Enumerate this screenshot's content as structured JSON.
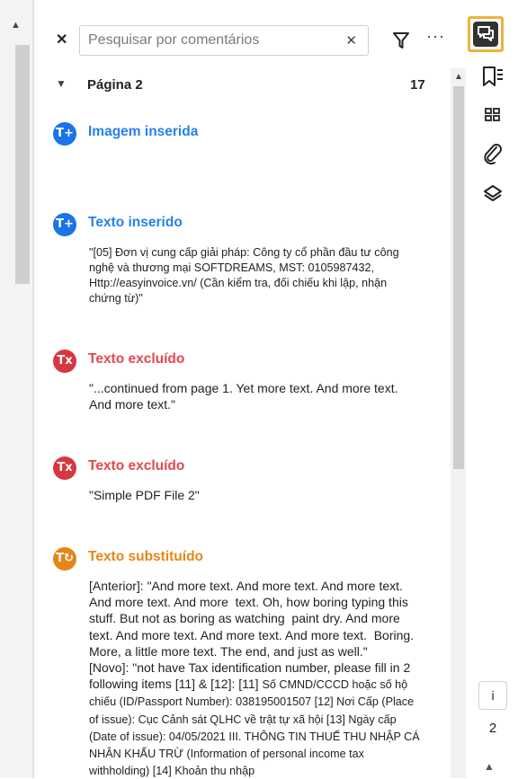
{
  "search": {
    "placeholder": "Pesquisar por comentários",
    "value": ""
  },
  "toolbar": {
    "more_label": "···"
  },
  "page_group": {
    "title": "Página 2",
    "count": "17"
  },
  "comments": [
    {
      "type": "Imagem inserida",
      "icon": "text-insert-icon",
      "color": "#2680eb",
      "body": ""
    },
    {
      "type": "Texto inserido",
      "icon": "text-insert-icon",
      "color": "#2680eb",
      "body": "\"[05] Đơn vị cung cấp giải pháp: Công ty cổ phần đầu tư công nghệ và thương mại SOFTDREAMS, MST: 0105987432, Http://easyinvoice.vn/ (Cần kiểm tra, đối chiếu khi lập, nhận chứng từ)\""
    },
    {
      "type": "Texto excluído",
      "icon": "text-strike-icon",
      "color": "#e34850",
      "body": "\"...continued from page 1. Yet more text. And more text. And more text.\""
    },
    {
      "type": "Texto excluído",
      "icon": "text-strike-icon",
      "color": "#e34850",
      "body": "\"Simple PDF File 2\""
    },
    {
      "type": "Texto substituído",
      "icon": "text-replace-icon",
      "color": "#e68619",
      "body_prefix": "[Anterior]: \"And more text. And more text. And more text. And more text. And more  text. Oh, how boring typing this stuff. But not as boring as watching  paint dry. And more text. And more text. And more text. And more text.  Boring. More, a little more text. The end, and just as well.\"\n[Novo]: \"not have Tax identification number, please fill in 2 following items [11] & [12]: [11] ",
      "body_small": "Số CMND/CCCD hoặc số hộ chiếu (ID/Passport Number): 038195001507 [12] Nơi Cấp (Place of issue): Cục Cảnh sát QLHC về trật tự xã hội [13] Ngày cấp (Date of issue): 04/05/2021 III. THÔNG TIN THUẾ THU NHẬP CÁ NHÂN KHẤU TRỪ (Information of personal income tax withholding) [14] Khoản thu nhập"
    }
  ],
  "right_rail": {
    "tools": [
      "comment-icon",
      "bookmark-icon",
      "thumbnails-icon",
      "attachment-icon",
      "layers-icon"
    ],
    "page_info_label": "i",
    "page_number": "2",
    "accent_color": "#f0b13a"
  }
}
